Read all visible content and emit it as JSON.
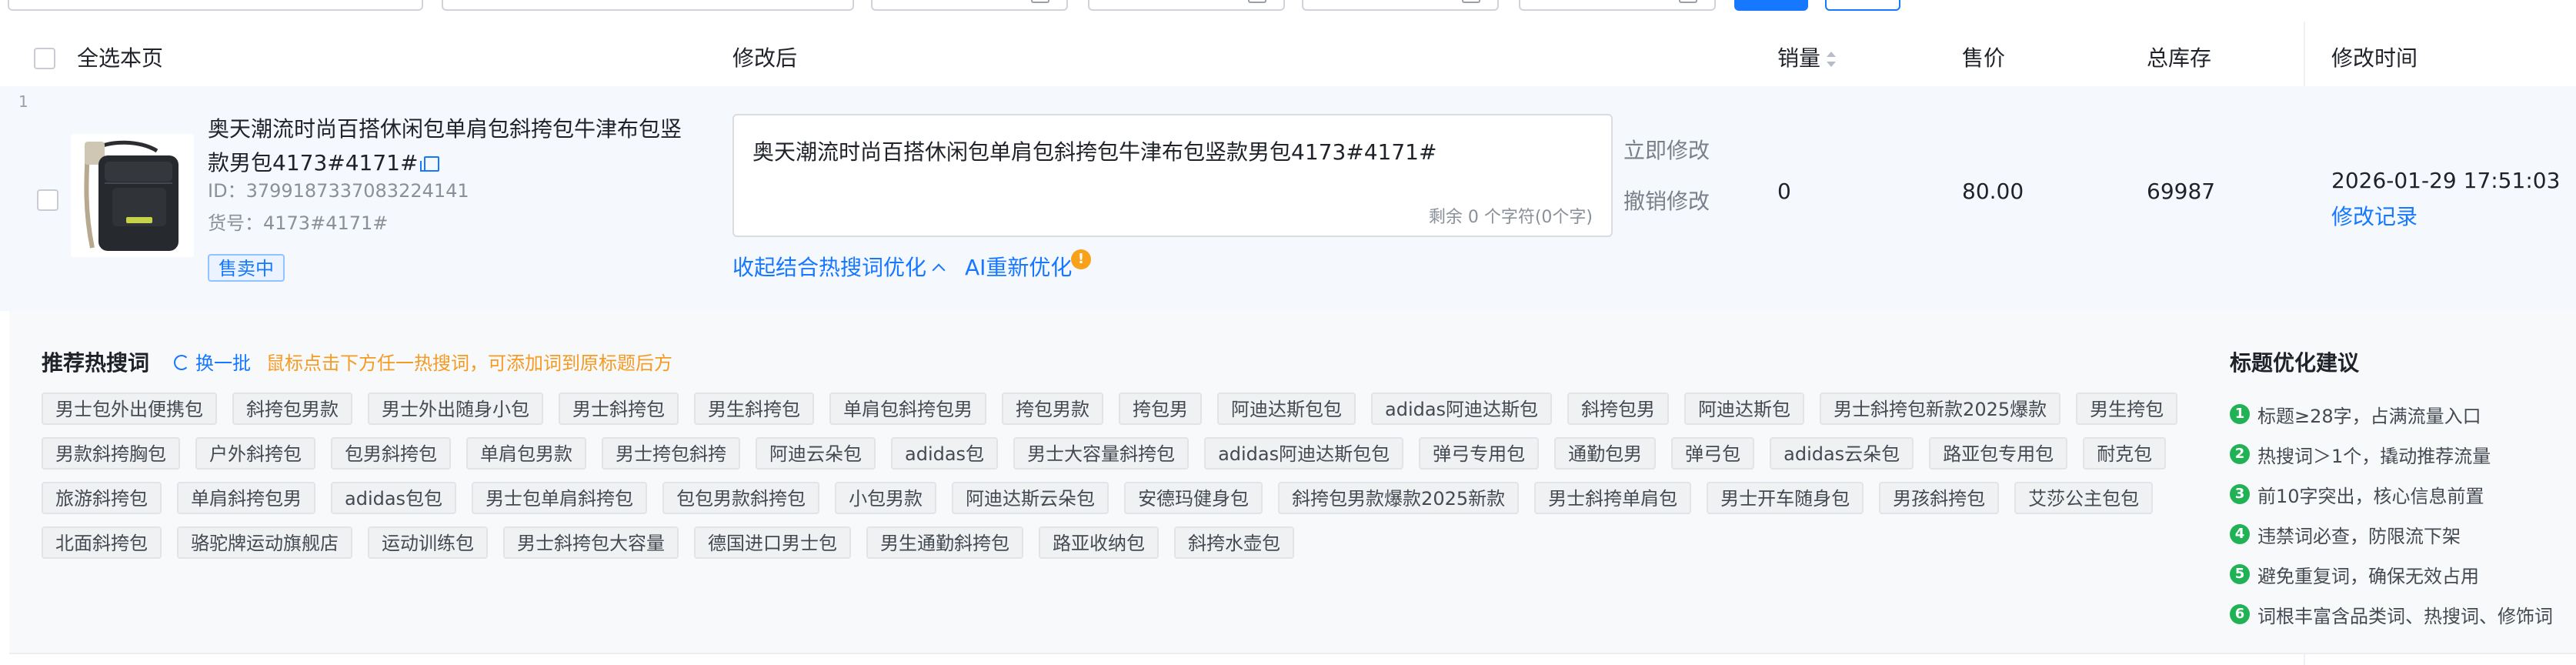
{
  "header": {
    "select_page": "全选本页",
    "after_edit": "修改后",
    "sales": "销量",
    "price": "售价",
    "total_stock": "总库存",
    "modified_time": "修改时间"
  },
  "row": {
    "index": "1",
    "title": "奥天潮流时尚百搭休闲包单肩包斜挎包牛津布包竖款男包4173#4171#",
    "id_label": "ID：",
    "id_value": "3799187337083224141",
    "sku_label": "货号：",
    "sku_value": "4173#4171#",
    "status_badge": "售卖中",
    "edit_value": "奥天潮流时尚百搭休闲包单肩包斜挎包牛津布包竖款男包4173#4171#",
    "edit_remaining": "剩余 0 个字符(0个字)",
    "apply_now": "立即修改",
    "undo_edit": "撤销修改",
    "hot_toggle": "收起结合热搜词优化",
    "ai_reoptimize": "AI重新优化",
    "sales": "0",
    "price": "80.00",
    "stock": "69987",
    "modified_time": "2026-01-29 17:51:03",
    "modify_record": "修改记录"
  },
  "hot_panel": {
    "title": "推荐热搜词",
    "refresh": "换一批",
    "hint": "鼠标点击下方任一热搜词，可添加词到原标题后方",
    "rows": [
      [
        "男士包外出便携包",
        "斜挎包男款",
        "男士外出随身小包",
        "男士斜挎包",
        "男生斜挎包",
        "单肩包斜挎包男",
        "挎包男款",
        "挎包男",
        "阿迪达斯包包",
        "adidas阿迪达斯包",
        "斜挎包男",
        "阿迪达斯包",
        "男士斜挎包新款2025爆款",
        "男生挎包"
      ],
      [
        "男款斜挎胸包",
        "户外斜挎包",
        "包男斜挎包",
        "单肩包男款",
        "男士挎包斜挎",
        "阿迪云朵包",
        "adidas包",
        "男士大容量斜挎包",
        "adidas阿迪达斯包包",
        "弹弓专用包",
        "通勤包男",
        "弹弓包",
        "adidas云朵包",
        "路亚包专用包",
        "耐克包"
      ],
      [
        "旅游斜挎包",
        "单肩斜挎包男",
        "adidas包包",
        "男士包单肩斜挎包",
        "包包男款斜挎包",
        "小包男款",
        "阿迪达斯云朵包",
        "安德玛健身包",
        "斜挎包男款爆款2025新款",
        "男士斜挎单肩包",
        "男士开车随身包",
        "男孩斜挎包",
        "艾莎公主包包"
      ],
      [
        "北面斜挎包",
        "骆驼牌运动旗舰店",
        "运动训练包",
        "男士斜挎包大容量",
        "德国进口男士包",
        "男生通勤斜挎包",
        "路亚收纳包",
        "斜挎水壶包"
      ]
    ],
    "suggest_title": "标题优化建议",
    "suggestions": [
      {
        "num": "1",
        "text": "标题≥28字，占满流量入口"
      },
      {
        "num": "2",
        "text": "热搜词＞1个，撬动推荐流量"
      },
      {
        "num": "3",
        "text": "前10字突出，核心信息前置"
      },
      {
        "num": "4",
        "text": "违禁词必查，防限流下架"
      },
      {
        "num": "5",
        "text": "避免重复词，确保无效占用"
      },
      {
        "num": "6",
        "text": "词根丰富含品类词、热搜词、修饰词"
      }
    ]
  },
  "colors": {
    "primary": "#1677ff",
    "row_bg": "#f5f8fd",
    "hint": "#f59a23",
    "success": "#20b255",
    "warning": "#f7a21a"
  }
}
